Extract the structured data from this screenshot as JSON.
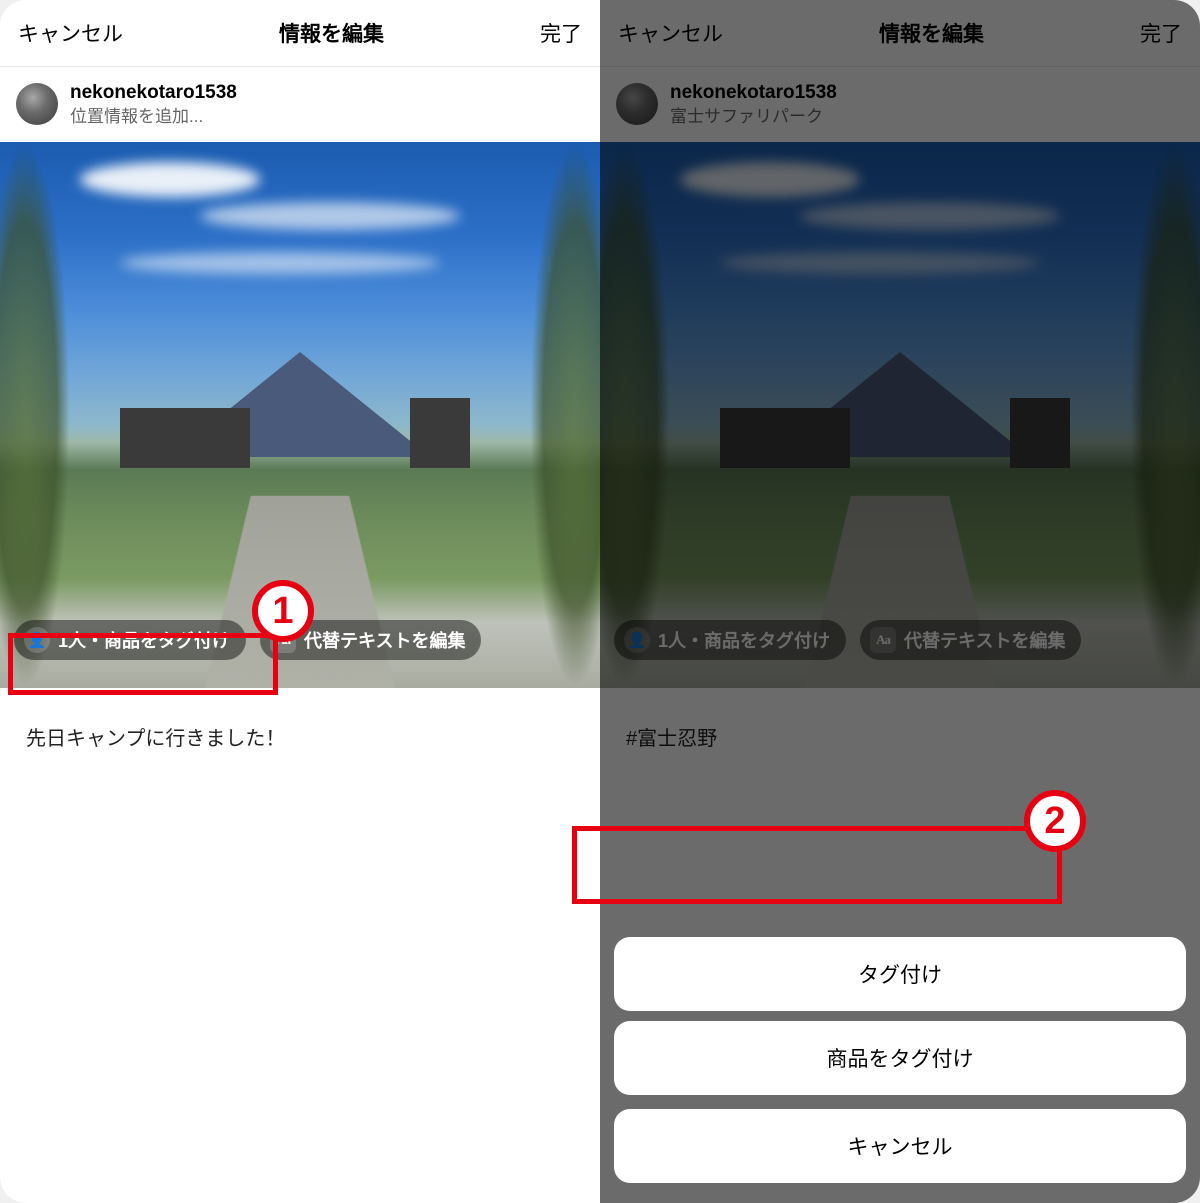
{
  "left": {
    "header": {
      "cancel": "キャンセル",
      "title": "情報を編集",
      "done": "完了"
    },
    "user": {
      "name": "nekonekotaro1538",
      "location": "位置情報を追加..."
    },
    "pills": {
      "tag": "1人・商品をタグ付け",
      "alt": "代替テキストを編集"
    },
    "caption": "先日キャンプに行きました！"
  },
  "right": {
    "header": {
      "cancel": "キャンセル",
      "title": "情報を編集",
      "done": "完了"
    },
    "user": {
      "name": "nekonekotaro1538",
      "location": "富士サファリパーク"
    },
    "pills": {
      "tag": "1人・商品をタグ付け",
      "alt": "代替テキストを編集"
    },
    "caption": "#富士忍野",
    "sheet": {
      "tag_people": "タグ付け",
      "tag_product": "商品をタグ付け",
      "cancel": "キャンセル"
    }
  },
  "annotations": {
    "one": "1",
    "two": "2"
  },
  "icons": {
    "person": "👤",
    "aa": "Aa"
  }
}
